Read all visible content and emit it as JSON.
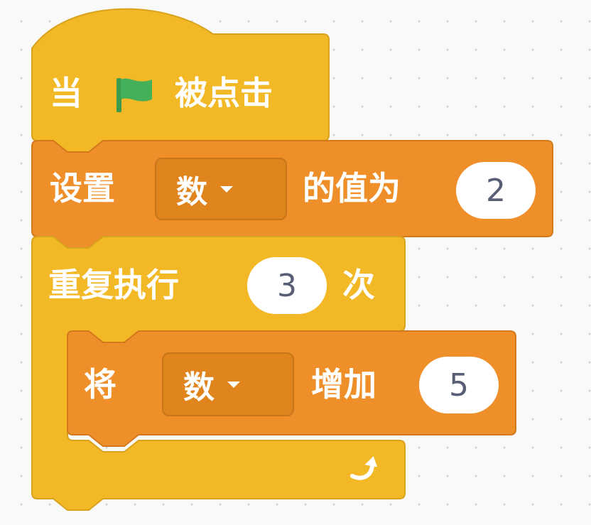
{
  "colors": {
    "events": "#f2b826",
    "events_border": "#d9a21c",
    "variables": "#ef8f2a",
    "variables_border": "#d3791c",
    "control": "#f2b826",
    "control_border": "#d9a21c",
    "flag_green": "#45b05a",
    "text": "#ffffff",
    "input_text": "#575e75"
  },
  "hat_block": {
    "prefix": "当",
    "icon": "green-flag-icon",
    "suffix": "被点击"
  },
  "set_block": {
    "label": "设置",
    "variable": "数",
    "middle": "的值为",
    "value": "2"
  },
  "repeat_block": {
    "label": "重复执行",
    "times": "3",
    "suffix": "次",
    "icon": "loop-arrow-icon"
  },
  "change_block": {
    "label": "将",
    "variable": "数",
    "middle": "增加",
    "value": "5"
  }
}
